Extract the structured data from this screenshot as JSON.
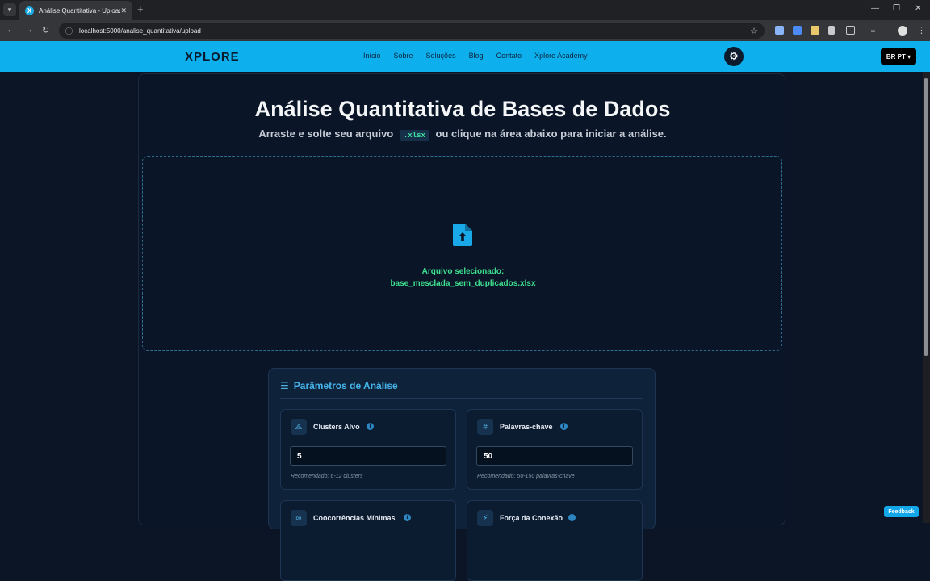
{
  "browser": {
    "tab_title": "Análise Quantitativa - Upload",
    "url": "localhost:5000/analise_quantitativa/upload"
  },
  "site": {
    "logo": "XPLORE",
    "menu": [
      "Início",
      "Sobre",
      "Soluções",
      "Blog",
      "Contato",
      "Xplore Academy"
    ],
    "lang": "BR PT"
  },
  "main": {
    "title": "Análise Quantitativa de Bases de Dados",
    "subtitle_before": "Arraste e solte seu arquivo",
    "subtitle_code": ".xlsx",
    "subtitle_after": "ou clique na área abaixo para iniciar a análise.",
    "selected_label": "Arquivo selecionado:",
    "selected_file": "base_mesclada_sem_duplicados.xlsx"
  },
  "params": {
    "title": "Parâmetros de Análise",
    "cards": [
      {
        "label": "Clusters Alvo",
        "value": "5",
        "hint": "Recomendado: 6-12 clusters",
        "icon": "cluster-icon"
      },
      {
        "label": "Palavras-chave",
        "value": "50",
        "hint": "Recomendado: 50-150 palavras-chave",
        "icon": "hash-icon"
      },
      {
        "label": "Coocorrências Mínimas",
        "value": "",
        "hint": "",
        "icon": "link-icon"
      },
      {
        "label": "Força da Conexão",
        "value": "",
        "hint": "",
        "icon": "bolt-icon"
      }
    ]
  },
  "feedback": "Feedback",
  "colors": {
    "accent": "#0db0ec",
    "bg": "#0b1526",
    "success": "#3fe08f"
  }
}
